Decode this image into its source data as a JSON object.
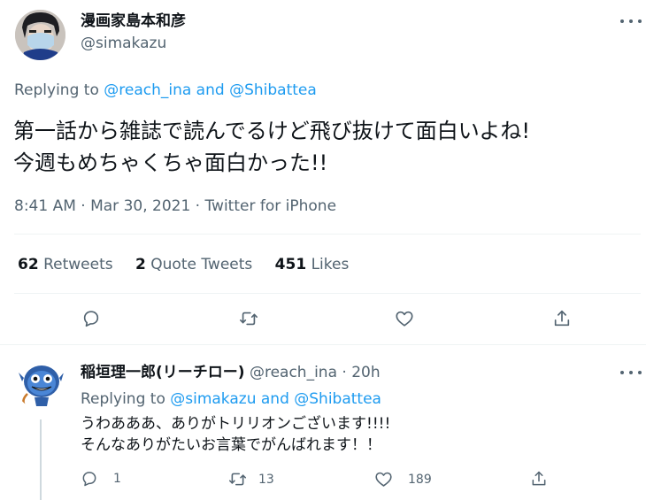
{
  "main_tweet": {
    "display_name": "漫画家島本和彦",
    "handle": "@simakazu",
    "replying_prefix": "Replying to ",
    "replying_to_1": "@reach_ina",
    "replying_and": " and ",
    "replying_to_2": "@Shibattea",
    "text_line1": "第一話から雑誌で読んでるけど飛び抜けて面白いよね!",
    "text_line2": "今週もめちゃくちゃ面白かった!!",
    "meta_time": "8:41 AM · Mar 30, 2021 · ",
    "meta_source": "Twitter for iPhone",
    "stats": {
      "retweets_count": "62",
      "retweets_label": "Retweets",
      "quotes_count": "2",
      "quotes_label": "Quote Tweets",
      "likes_count": "451",
      "likes_label": "Likes"
    }
  },
  "reply_tweet": {
    "display_name": "稲垣理一郎(リーチロー)",
    "handle_time": "@reach_ina · 20h",
    "replying_prefix": "Replying to ",
    "replying_to_1": "@simakazu",
    "replying_and": " and ",
    "replying_to_2": "@Shibattea",
    "text_line1": "うわあああ、ありがトリリオンございます!!!!",
    "text_line2": "そんなありがたいお言葉でがんばれます！！",
    "reply_count": "1",
    "retweet_count": "13",
    "like_count": "189"
  },
  "icons": {
    "reply": "reply-icon",
    "retweet": "retweet-icon",
    "like": "heart-icon",
    "share": "share-icon",
    "more": "more-icon"
  },
  "colors": {
    "accent": "#1d9bf0",
    "muted": "#536471",
    "text": "#0f1419"
  }
}
